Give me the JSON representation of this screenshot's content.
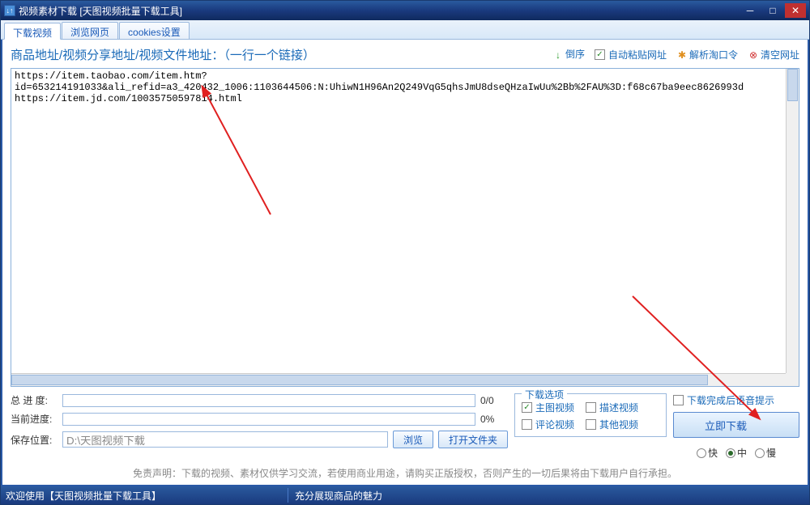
{
  "titlebar": {
    "icon": "↓↑",
    "text": "视频素材下载 [天图视频批量下载工具]"
  },
  "tabs": [
    {
      "label": "下载视频",
      "active": true
    },
    {
      "label": "浏览网页",
      "active": false
    },
    {
      "label": "cookies设置",
      "active": false
    }
  ],
  "header": {
    "label": "商品地址/视频分享地址/视频文件地址：（一行一个链接）",
    "sort": "倒序",
    "autopaste": "自动粘贴网址",
    "parse": "解析淘口令",
    "clear": "清空网址"
  },
  "textarea_lines": [
    "https://item.taobao.com/item.htm?id=653214191033&ali_refid=a3_420432_1006:1103644506:N:UhiwN1H96An2Q249VqG5qhsJmU8dseQHzaIwUu%2Bb%2FAU%3D:f68c67ba9eec8626993d",
    "https://item.jd.com/10035750597814.html"
  ],
  "progress": {
    "total_label": "总 进 度:",
    "total_text": "0/0",
    "current_label": "当前进度:",
    "current_text": "0%"
  },
  "save": {
    "label": "保存位置:",
    "path": "D:\\天图视频下载",
    "browse": "浏览",
    "open": "打开文件夹"
  },
  "options": {
    "title": "下载选项",
    "main_video": "主图视频",
    "desc_video": "描述视频",
    "comment_video": "评论视频",
    "other_video": "其他视频"
  },
  "right": {
    "voice": "下载完成后语音提示",
    "download": "立即下载",
    "fast": "快",
    "medium": "中",
    "slow": "慢"
  },
  "disclaimer": "免责声明：下载的视频、素材仅供学习交流，若使用商业用途，请购买正版授权，否则产生的一切后果将由下载用户自行承担。",
  "statusbar": {
    "left": "欢迎使用【天图视频批量下载工具】",
    "right": "充分展现商品的魅力"
  }
}
